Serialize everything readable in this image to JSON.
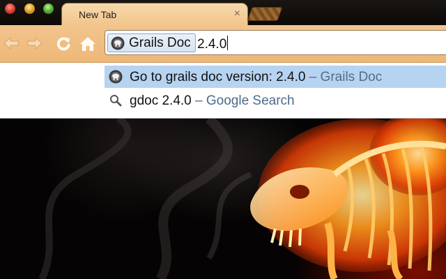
{
  "window": {
    "controls": [
      "close",
      "minimize",
      "zoom"
    ]
  },
  "tab": {
    "title": "New Tab",
    "close_glyph": "×"
  },
  "toolbar": {
    "buttons": [
      "back-icon",
      "forward-icon",
      "reload-icon",
      "home-icon"
    ]
  },
  "omnibox": {
    "keyword_label": "Grails Doc",
    "keyword_icon": "grails-icon",
    "text": "2.4.0"
  },
  "suggestions": [
    {
      "icon": "grails-icon",
      "text": "Go to grails doc version: 2.4.0",
      "description": " – Grails Doc",
      "selected": true
    },
    {
      "icon": "search-icon",
      "text": "gdoc 2.4.0",
      "description": " – Google Search",
      "selected": false
    }
  ],
  "colors": {
    "tab_bg": "#f1c48a",
    "toolbar_bg": "#eeb877",
    "selection": "#b6d3f1",
    "description_text": "#556d86"
  }
}
